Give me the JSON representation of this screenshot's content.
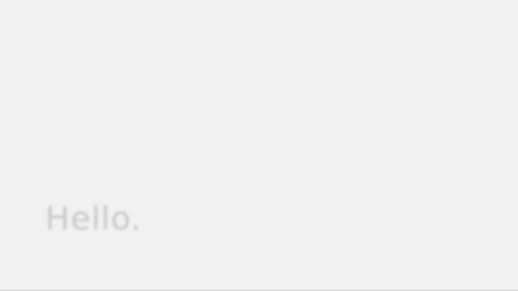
{
  "greeting_text": "Hello.",
  "right_text": ""
}
